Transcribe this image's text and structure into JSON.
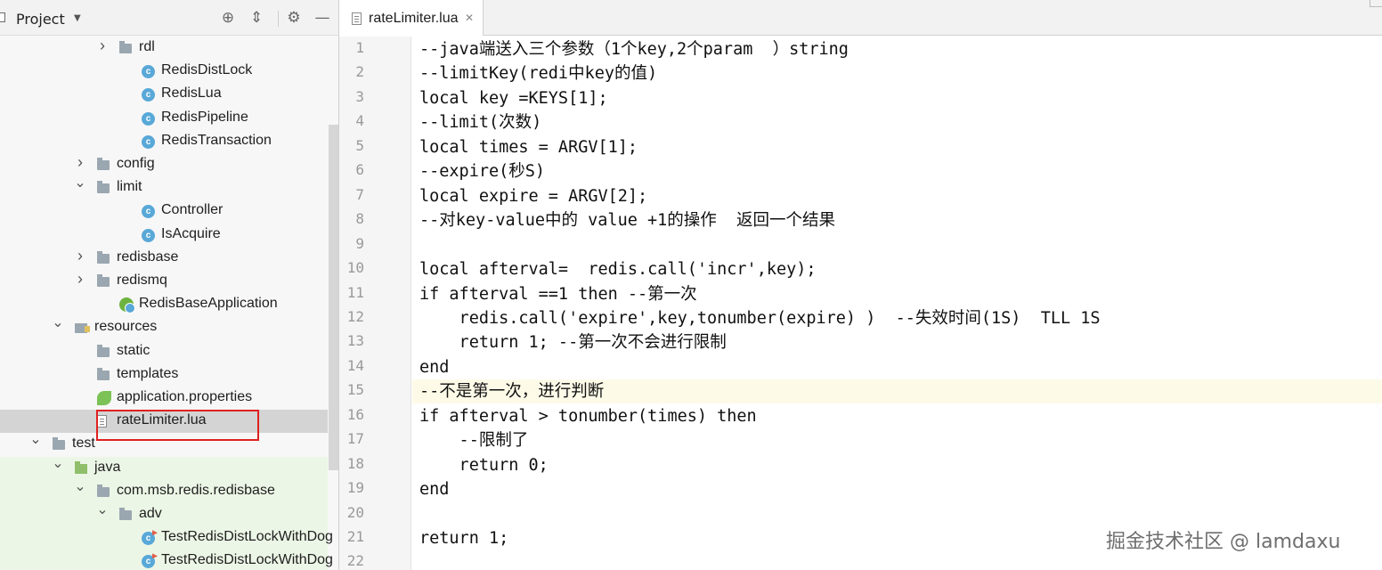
{
  "project_panel": {
    "title": "Project",
    "tools": [
      "target-icon",
      "collapse-icon",
      "gear-icon",
      "minimize-icon"
    ],
    "tree": [
      {
        "label": "rdl",
        "icon": "folder",
        "arrow": "collapsed",
        "indent": 2
      },
      {
        "label": "RedisDistLock",
        "icon": "class",
        "arrow": "",
        "indent": 3
      },
      {
        "label": "RedisLua",
        "icon": "class",
        "arrow": "",
        "indent": 3
      },
      {
        "label": "RedisPipeline",
        "icon": "class",
        "arrow": "",
        "indent": 3
      },
      {
        "label": "RedisTransaction",
        "icon": "class",
        "arrow": "",
        "indent": 3
      },
      {
        "label": "config",
        "icon": "folder",
        "arrow": "collapsed",
        "indent": 1
      },
      {
        "label": "limit",
        "icon": "folder",
        "arrow": "expanded",
        "indent": 1
      },
      {
        "label": "Controller",
        "icon": "class",
        "arrow": "",
        "indent": 3
      },
      {
        "label": "IsAcquire",
        "icon": "class",
        "arrow": "",
        "indent": 3
      },
      {
        "label": "redisbase",
        "icon": "folder",
        "arrow": "collapsed",
        "indent": 1
      },
      {
        "label": "redismq",
        "icon": "folder",
        "arrow": "collapsed",
        "indent": 1
      },
      {
        "label": "RedisBaseApplication",
        "icon": "spring",
        "arrow": "",
        "indent": 2
      },
      {
        "label": "resources",
        "icon": "resfolder",
        "arrow": "expanded",
        "indent": 0
      },
      {
        "label": "static",
        "icon": "folder",
        "arrow": "",
        "indent": 1
      },
      {
        "label": "templates",
        "icon": "folder",
        "arrow": "",
        "indent": 1
      },
      {
        "label": "application.properties",
        "icon": "props",
        "arrow": "",
        "indent": 1
      },
      {
        "label": "rateLimiter.lua",
        "icon": "file",
        "arrow": "",
        "indent": 1,
        "selected": true
      },
      {
        "label": "test",
        "icon": "folder",
        "arrow": "expanded",
        "indent": -1
      },
      {
        "label": "java",
        "icon": "folder-green",
        "arrow": "expanded",
        "indent": 0,
        "green": true
      },
      {
        "label": "com.msb.redis.redisbase",
        "icon": "folder",
        "arrow": "expanded",
        "indent": 1,
        "green": true
      },
      {
        "label": "adv",
        "icon": "folder",
        "arrow": "expanded",
        "indent": 2,
        "green": true
      },
      {
        "label": "TestRedisDistLockWithDog",
        "icon": "test",
        "arrow": "",
        "indent": 3,
        "green": true
      },
      {
        "label": "TestRedisDistLockWithDog",
        "icon": "test",
        "arrow": "",
        "indent": 3,
        "green": true
      }
    ]
  },
  "editor": {
    "tab_name": "rateLimiter.lua",
    "current_line": 15,
    "lines": [
      "--java端送入三个参数（1个key,2个param  ）string",
      "--limitKey(redi中key的值)",
      "local key =KEYS[1];",
      "--limit(次数)",
      "local times = ARGV[1];",
      "--expire(秒S)",
      "local expire = ARGV[2];",
      "--对key-value中的 value +1的操作  返回一个结果",
      "",
      "local afterval=  redis.call('incr',key);",
      "if afterval ==1 then --第一次",
      "    redis.call('expire',key,tonumber(expire) )  --失效时间(1S)  TLL 1S",
      "    return 1; --第一次不会进行限制",
      "end",
      "--不是第一次，进行判断",
      "if afterval > tonumber(times) then",
      "    --限制了",
      "    return 0;",
      "end",
      "",
      "return 1;",
      ""
    ]
  },
  "watermark": "掘金技术社区 @ lamdaxu"
}
